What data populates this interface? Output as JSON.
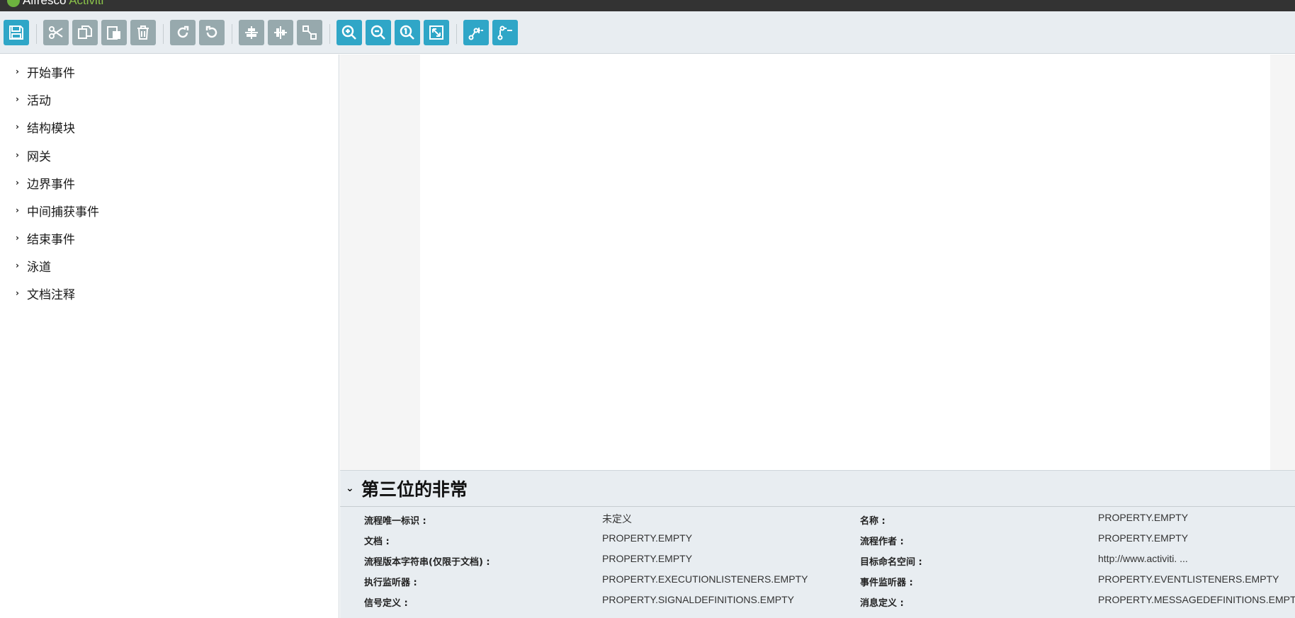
{
  "logo": {
    "brand": "Alfresco",
    "product": "Activiti"
  },
  "toolbar": {
    "buttons": [
      {
        "name": "save",
        "style": "blue"
      },
      {
        "name": "cut",
        "style": "gray"
      },
      {
        "name": "copy",
        "style": "gray"
      },
      {
        "name": "paste",
        "style": "gray"
      },
      {
        "name": "delete",
        "style": "gray"
      },
      {
        "name": "redo",
        "style": "gray"
      },
      {
        "name": "undo",
        "style": "gray"
      },
      {
        "name": "align-horizontal",
        "style": "gray"
      },
      {
        "name": "align-vertical",
        "style": "gray"
      },
      {
        "name": "same-size",
        "style": "gray"
      },
      {
        "name": "zoom-in",
        "style": "blue"
      },
      {
        "name": "zoom-out",
        "style": "blue"
      },
      {
        "name": "zoom-actual",
        "style": "blue"
      },
      {
        "name": "zoom-fit",
        "style": "blue"
      },
      {
        "name": "add-bendpoint",
        "style": "blue"
      },
      {
        "name": "remove-bendpoint",
        "style": "blue"
      }
    ]
  },
  "palette": {
    "items": [
      "开始事件",
      "活动",
      "结构模块",
      "网关",
      "边界事件",
      "中间捕获事件",
      "结束事件",
      "泳道",
      "文档注释"
    ]
  },
  "properties": {
    "title": "第三位的非常",
    "rows": [
      {
        "label": "流程唯一标识 :",
        "value": "未定义",
        "label2": "名称 :",
        "value2": "PROPERTY.EMPTY"
      },
      {
        "label": "文档 :",
        "value": "PROPERTY.EMPTY",
        "label2": "流程作者 :",
        "value2": "PROPERTY.EMPTY"
      },
      {
        "label": "流程版本字符串(仅限于文档) :",
        "value": "PROPERTY.EMPTY",
        "label2": "目标命名空间 :",
        "value2": "http://www.activiti. ..."
      },
      {
        "label": "执行监听器 :",
        "value": "PROPERTY.EXECUTIONLISTENERS.EMPTY",
        "label2": "事件监听器 :",
        "value2": "PROPERTY.EVENTLISTENERS.EMPTY"
      },
      {
        "label": "信号定义 :",
        "value": "PROPERTY.SIGNALDEFINITIONS.EMPTY",
        "label2": "消息定义 :",
        "value2": "PROPERTY.MESSAGEDEFINITIONS.EMPTY"
      }
    ]
  },
  "colors": {
    "accent": "#2fa6c7",
    "disabled": "#97a9ad",
    "toolbar_bg": "#e8edf1",
    "topbar_bg": "#333333"
  }
}
